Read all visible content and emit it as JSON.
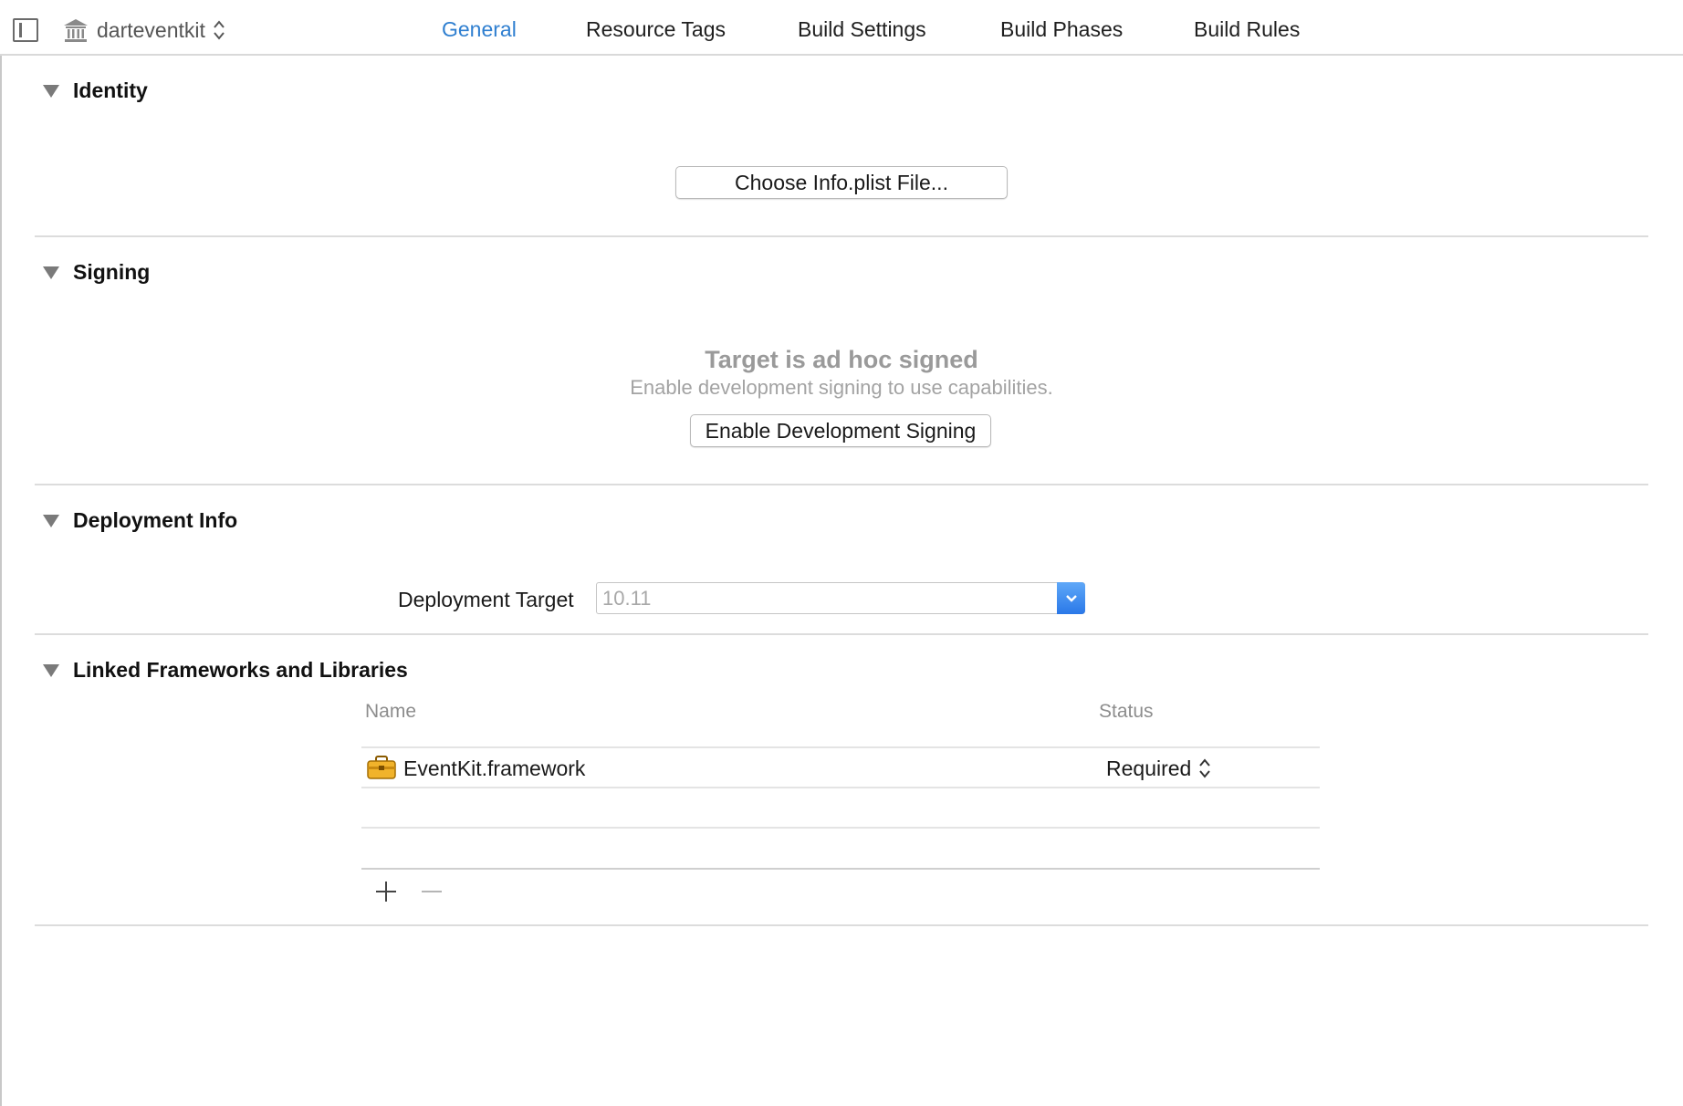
{
  "toolbar": {
    "target_name": "darteventkit",
    "tabs": [
      {
        "label": "General",
        "active": true
      },
      {
        "label": "Resource Tags",
        "active": false
      },
      {
        "label": "Build Settings",
        "active": false
      },
      {
        "label": "Build Phases",
        "active": false
      },
      {
        "label": "Build Rules",
        "active": false
      }
    ]
  },
  "sections": {
    "identity": {
      "title": "Identity",
      "choose_plist_button": "Choose Info.plist File..."
    },
    "signing": {
      "title": "Signing",
      "status_title": "Target is ad hoc signed",
      "status_subtitle": "Enable development signing to use capabilities.",
      "enable_button": "Enable Development Signing"
    },
    "deployment": {
      "title": "Deployment Info",
      "target_label": "Deployment Target",
      "target_value": "10.11"
    },
    "frameworks": {
      "title": "Linked Frameworks and Libraries",
      "columns": {
        "name": "Name",
        "status": "Status"
      },
      "rows": [
        {
          "name": "EventKit.framework",
          "status": "Required",
          "icon": "toolbox-icon"
        }
      ]
    }
  },
  "colors": {
    "accent": "#2f7fd0",
    "dropdown_blue": "#2a78e8",
    "muted_text": "#9a9a9a"
  }
}
